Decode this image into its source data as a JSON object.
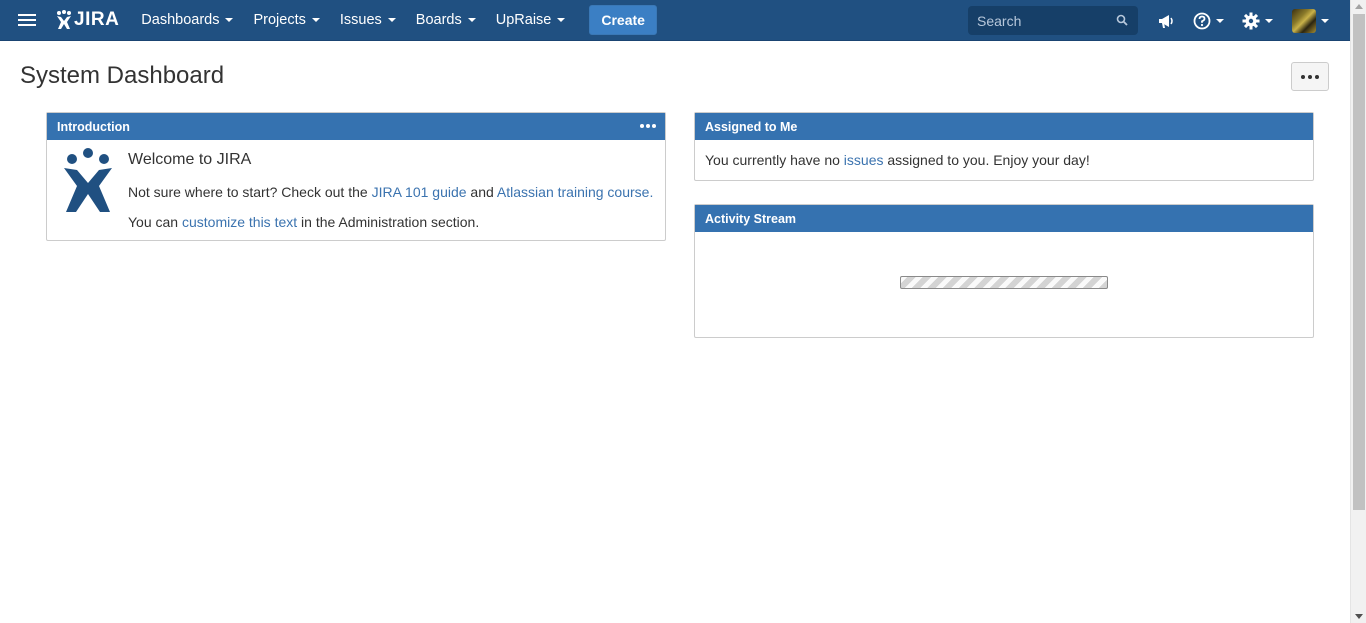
{
  "header": {
    "logo_text": "JIRA",
    "nav": [
      {
        "label": "Dashboards"
      },
      {
        "label": "Projects"
      },
      {
        "label": "Issues"
      },
      {
        "label": "Boards"
      },
      {
        "label": "UpRaise"
      }
    ],
    "create_label": "Create",
    "search_placeholder": "Search"
  },
  "page": {
    "title": "System Dashboard"
  },
  "introduction": {
    "title": "Introduction",
    "welcome": "Welcome to JIRA",
    "line1_prefix": "Not sure where to start? Check out the ",
    "link_jira101": "JIRA 101 guide",
    "line1_and": " and ",
    "link_training": "Atlassian training course.",
    "line2_prefix": "You can ",
    "link_customize": "customize this text",
    "line2_suffix": " in the Administration section."
  },
  "assigned": {
    "title": "Assigned to Me",
    "prefix": "You currently have no ",
    "link_issues": "issues",
    "suffix": " assigned to you. Enjoy your day!"
  },
  "activity": {
    "title": "Activity Stream"
  },
  "colors": {
    "header_bg": "#205081",
    "gadget_header": "#3572b0",
    "link": "#3b73af",
    "create_button": "#3b7fc4"
  }
}
